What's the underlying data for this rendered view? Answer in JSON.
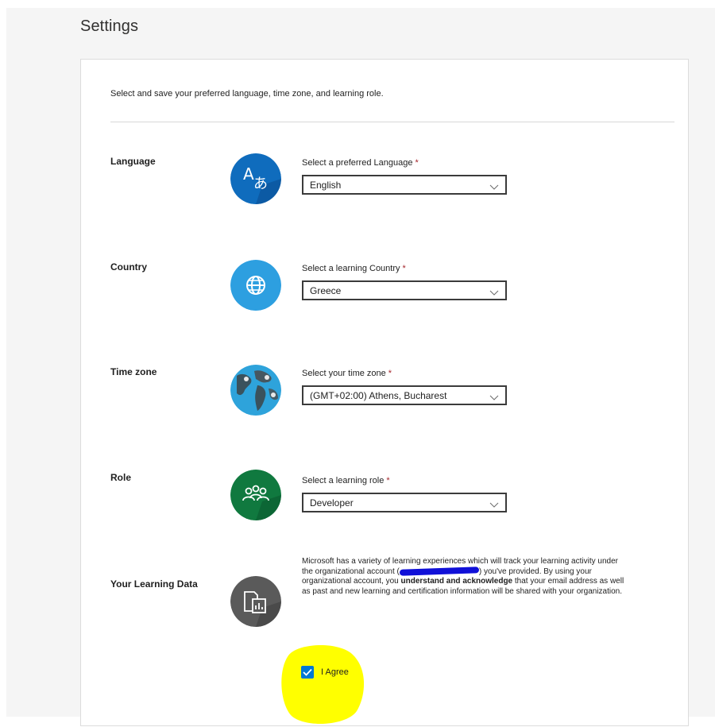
{
  "page": {
    "title": "Settings"
  },
  "intro": "Select and save your preferred language, time zone, and learning role.",
  "sections": {
    "language": {
      "label": "Language",
      "field_label": "Select a preferred Language",
      "required_mark": "*",
      "value": "English",
      "icon": "language-translate-icon"
    },
    "country": {
      "label": "Country",
      "field_label": "Select a learning Country",
      "required_mark": "*",
      "value": "Greece",
      "icon": "globe-icon"
    },
    "timezone": {
      "label": "Time zone",
      "field_label": "Select your time zone",
      "required_mark": "*",
      "value": "(GMT+02:00) Athens, Bucharest",
      "icon": "world-map-icon"
    },
    "role": {
      "label": "Role",
      "field_label": "Select a learning role",
      "required_mark": "*",
      "value": "Developer",
      "icon": "people-group-icon"
    },
    "learning_data": {
      "label": "Your Learning Data",
      "icon": "data-report-icon",
      "text_part1": "Microsoft has a variety of learning experiences which will track your learning activity under the organizational account (",
      "text_part2": ") you've provided. By using your organizational account, you ",
      "text_bold": "understand and acknowledge",
      "text_part3": " that your email address as well as past and new learning and certification information will be shared with your organization.",
      "agree_label": "I Agree",
      "agree_checked": true
    }
  },
  "colors": {
    "accent": "#0078d4",
    "language_icon_bg": "#0f6cbd",
    "country_icon_bg": "#2d9fe0",
    "role_icon_bg": "#10793f",
    "data_icon_bg": "#5a5a5a",
    "highlight": "#ffff00",
    "required": "#a4262c"
  }
}
